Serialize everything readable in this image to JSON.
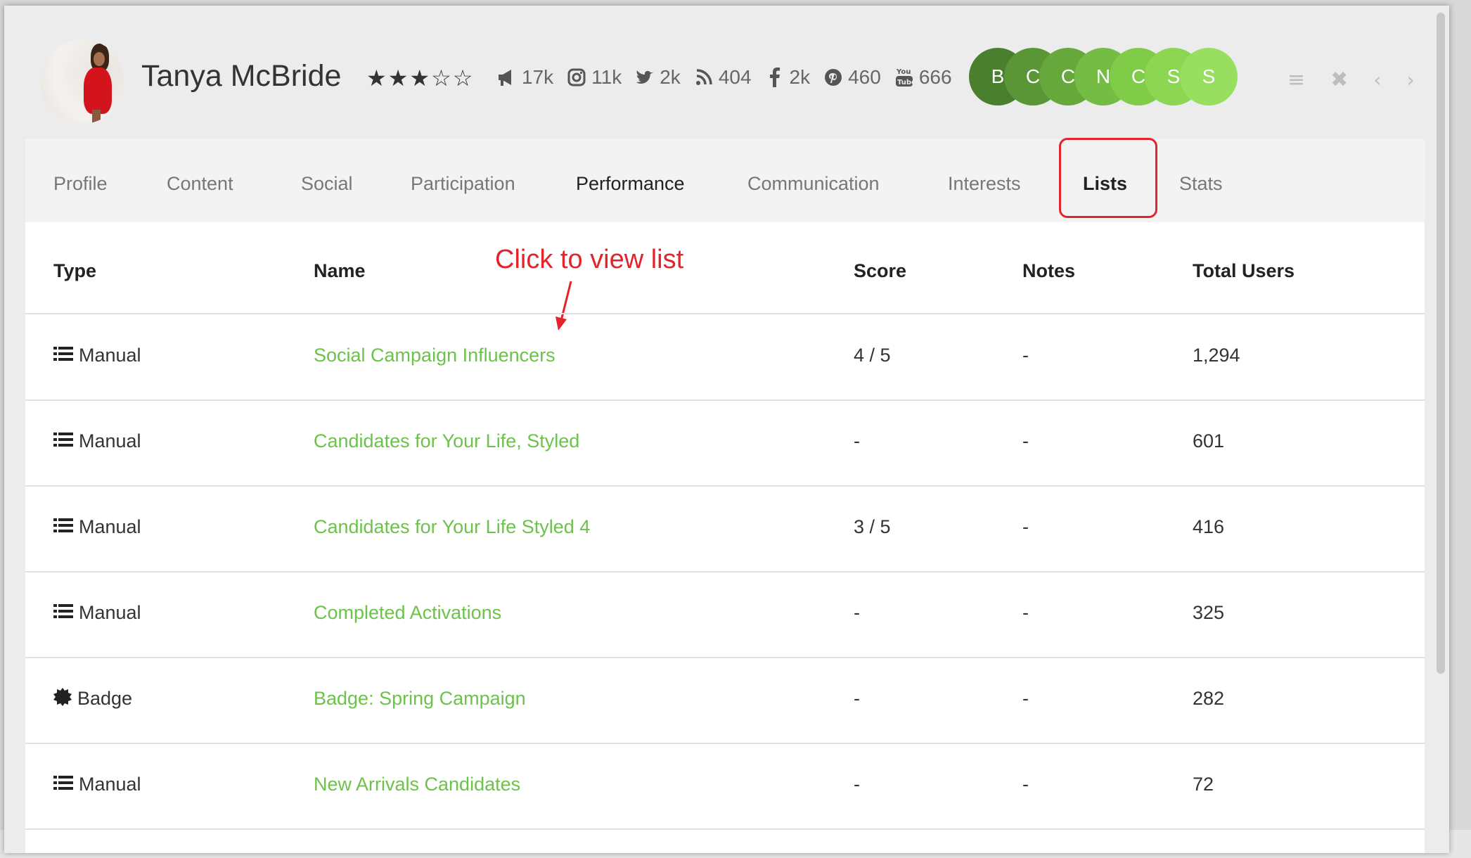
{
  "profile": {
    "name": "Tanya McBride",
    "rating": {
      "value": 3,
      "max": 5
    },
    "stats": [
      {
        "icon": "megaphone-icon",
        "value": "17k"
      },
      {
        "icon": "instagram-icon",
        "value": "11k"
      },
      {
        "icon": "twitter-icon",
        "value": "2k"
      },
      {
        "icon": "rss-icon",
        "value": "404"
      },
      {
        "icon": "facebook-icon",
        "value": "2k"
      },
      {
        "icon": "pinterest-icon",
        "value": "460"
      },
      {
        "icon": "youtube-icon",
        "value": "666"
      }
    ],
    "badges": [
      {
        "letter": "B",
        "color": "#4a7f2e"
      },
      {
        "letter": "C",
        "color": "#5a9635"
      },
      {
        "letter": "C",
        "color": "#66a83c"
      },
      {
        "letter": "N",
        "color": "#74bc44"
      },
      {
        "letter": "C",
        "color": "#80cc49"
      },
      {
        "letter": "S",
        "color": "#8cd653"
      },
      {
        "letter": "S",
        "color": "#98df60"
      }
    ]
  },
  "header_icons": [
    "hamburger-menu-icon",
    "close-icon",
    "chevron-left-icon",
    "chevron-right-icon"
  ],
  "tabs": [
    {
      "label": "Profile"
    },
    {
      "label": "Content"
    },
    {
      "label": "Social"
    },
    {
      "label": "Participation"
    },
    {
      "label": "Performance"
    },
    {
      "label": "Communication"
    },
    {
      "label": "Interests"
    },
    {
      "label": "Lists",
      "active": true
    },
    {
      "label": "Stats"
    }
  ],
  "annotation": "Click to view list",
  "table": {
    "columns": [
      "Type",
      "Name",
      "Score",
      "Notes",
      "Total Users"
    ],
    "rows": [
      {
        "type": "Manual",
        "type_icon": "list-icon",
        "name": "Social Campaign Influencers",
        "score": "4 / 5",
        "notes": "-",
        "total": "1,294"
      },
      {
        "type": "Manual",
        "type_icon": "list-icon",
        "name": "Candidates for Your Life, Styled",
        "score": "-",
        "notes": "-",
        "total": "601"
      },
      {
        "type": "Manual",
        "type_icon": "list-icon",
        "name": "Candidates for Your Life Styled 4",
        "score": "3 / 5",
        "notes": "-",
        "total": "416"
      },
      {
        "type": "Manual",
        "type_icon": "list-icon",
        "name": "Completed Activations",
        "score": "-",
        "notes": "-",
        "total": "325"
      },
      {
        "type": "Badge",
        "type_icon": "badge-icon",
        "name": "Badge: Spring Campaign",
        "score": "-",
        "notes": "-",
        "total": "282"
      },
      {
        "type": "Manual",
        "type_icon": "list-icon",
        "name": "New Arrivals Candidates",
        "score": "-",
        "notes": "-",
        "total": "72"
      }
    ]
  },
  "colors": {
    "link": "#6cc24a",
    "annotation": "#e3242b"
  }
}
